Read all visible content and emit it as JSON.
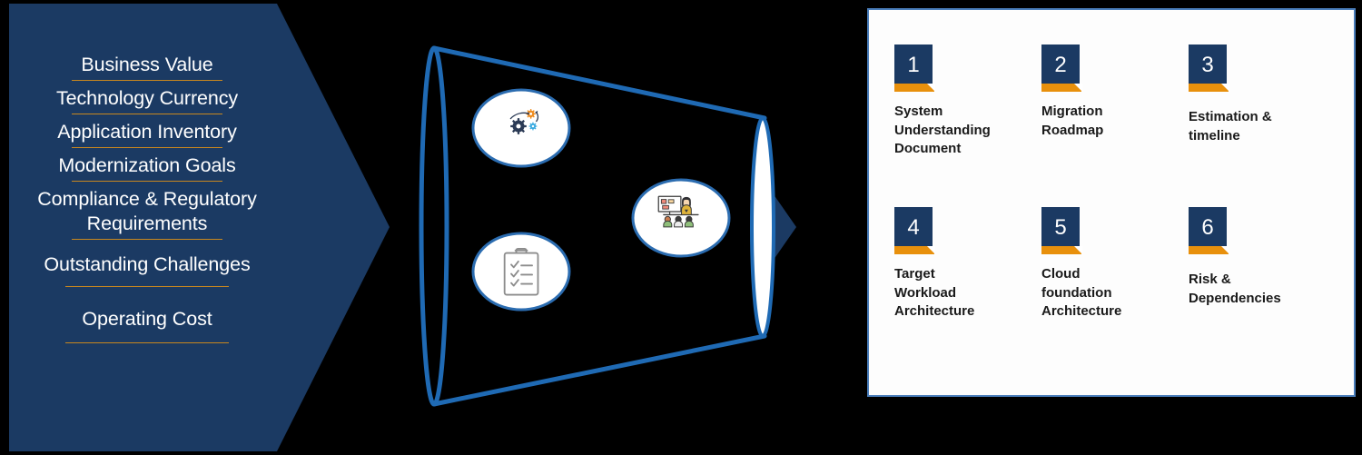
{
  "colors": {
    "navy": "#1b3a63",
    "orange_rule": "#c8871f",
    "badge_orange": "#e8900c",
    "funnel_blue": "#1f6ab4",
    "panel_border": "#4a7ebb",
    "panel_bg": "#fdfdfd"
  },
  "inputs": {
    "name": "assessment-inputs-arrow",
    "items": [
      {
        "label": "Business Value",
        "rule_width": 166
      },
      {
        "label": "Technology Currency",
        "rule_width": 166
      },
      {
        "label": "Application Inventory",
        "rule_width": 166
      },
      {
        "label": "Modernization Goals",
        "rule_width": 166
      },
      {
        "label": "Compliance & Regulatory\nRequirements",
        "rule_width": 166
      },
      {
        "label": "Outstanding Challenges",
        "rule_width": 180
      },
      {
        "label": "Operating Cost",
        "rule_width": 180
      }
    ]
  },
  "funnel": {
    "name": "assessment-funnel",
    "bubbles": [
      {
        "icon": "gears-process-icon",
        "label": "Process / Automation"
      },
      {
        "icon": "clipboard-checklist-icon",
        "label": "Assessment Checklist"
      },
      {
        "icon": "workshop-presentation-icon",
        "label": "Workshops"
      }
    ],
    "arrow_tip": "funnel-output-arrow"
  },
  "outputs": {
    "name": "deliverables-panel",
    "items": [
      {
        "number": "1",
        "label": "System\nUnderstanding\nDocument"
      },
      {
        "number": "2",
        "label": "Migration\nRoadmap"
      },
      {
        "number": "3",
        "label": "Estimation &\ntimeline"
      },
      {
        "number": "4",
        "label": "Target\nWorkload\nArchitecture"
      },
      {
        "number": "5",
        "label": "Cloud\nfoundation\nArchitecture"
      },
      {
        "number": "6",
        "label": "Risk &\nDependencies"
      }
    ]
  }
}
